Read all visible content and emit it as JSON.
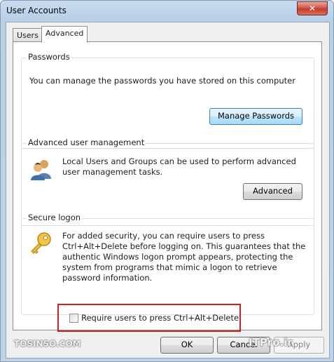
{
  "window": {
    "title": "User Accounts",
    "close_symbol": "✕"
  },
  "tabs": [
    {
      "label": "Users",
      "active": false
    },
    {
      "label": "Advanced",
      "active": true
    }
  ],
  "passwords": {
    "group_label": "Passwords",
    "description": "You can manage the passwords you have stored on this computer",
    "button_label": "Manage Passwords"
  },
  "advanced_user_management": {
    "group_label": "Advanced user management",
    "description": "Local Users and Groups can be used to perform advanced user management tasks.",
    "button_label": "Advanced"
  },
  "secure_logon": {
    "group_label": "Secure logon",
    "description": "For added security, you can require users to press Ctrl+Alt+Delete before logging on. This guarantees that the authentic Windows logon prompt appears, protecting the system from programs that mimic a logon to retrieve password information.",
    "checkbox_label": "Require users to press Ctrl+Alt+Delete",
    "checkbox_checked": false
  },
  "footer": {
    "ok_label": "OK",
    "cancel_label": "Cancel",
    "apply_label": "Apply"
  },
  "watermark": {
    "left_text": "TOSINSO.COM",
    "right_text": "ITPro.ir"
  },
  "colors": {
    "highlight": "#d21e1e",
    "close_button": "#c9463a"
  }
}
